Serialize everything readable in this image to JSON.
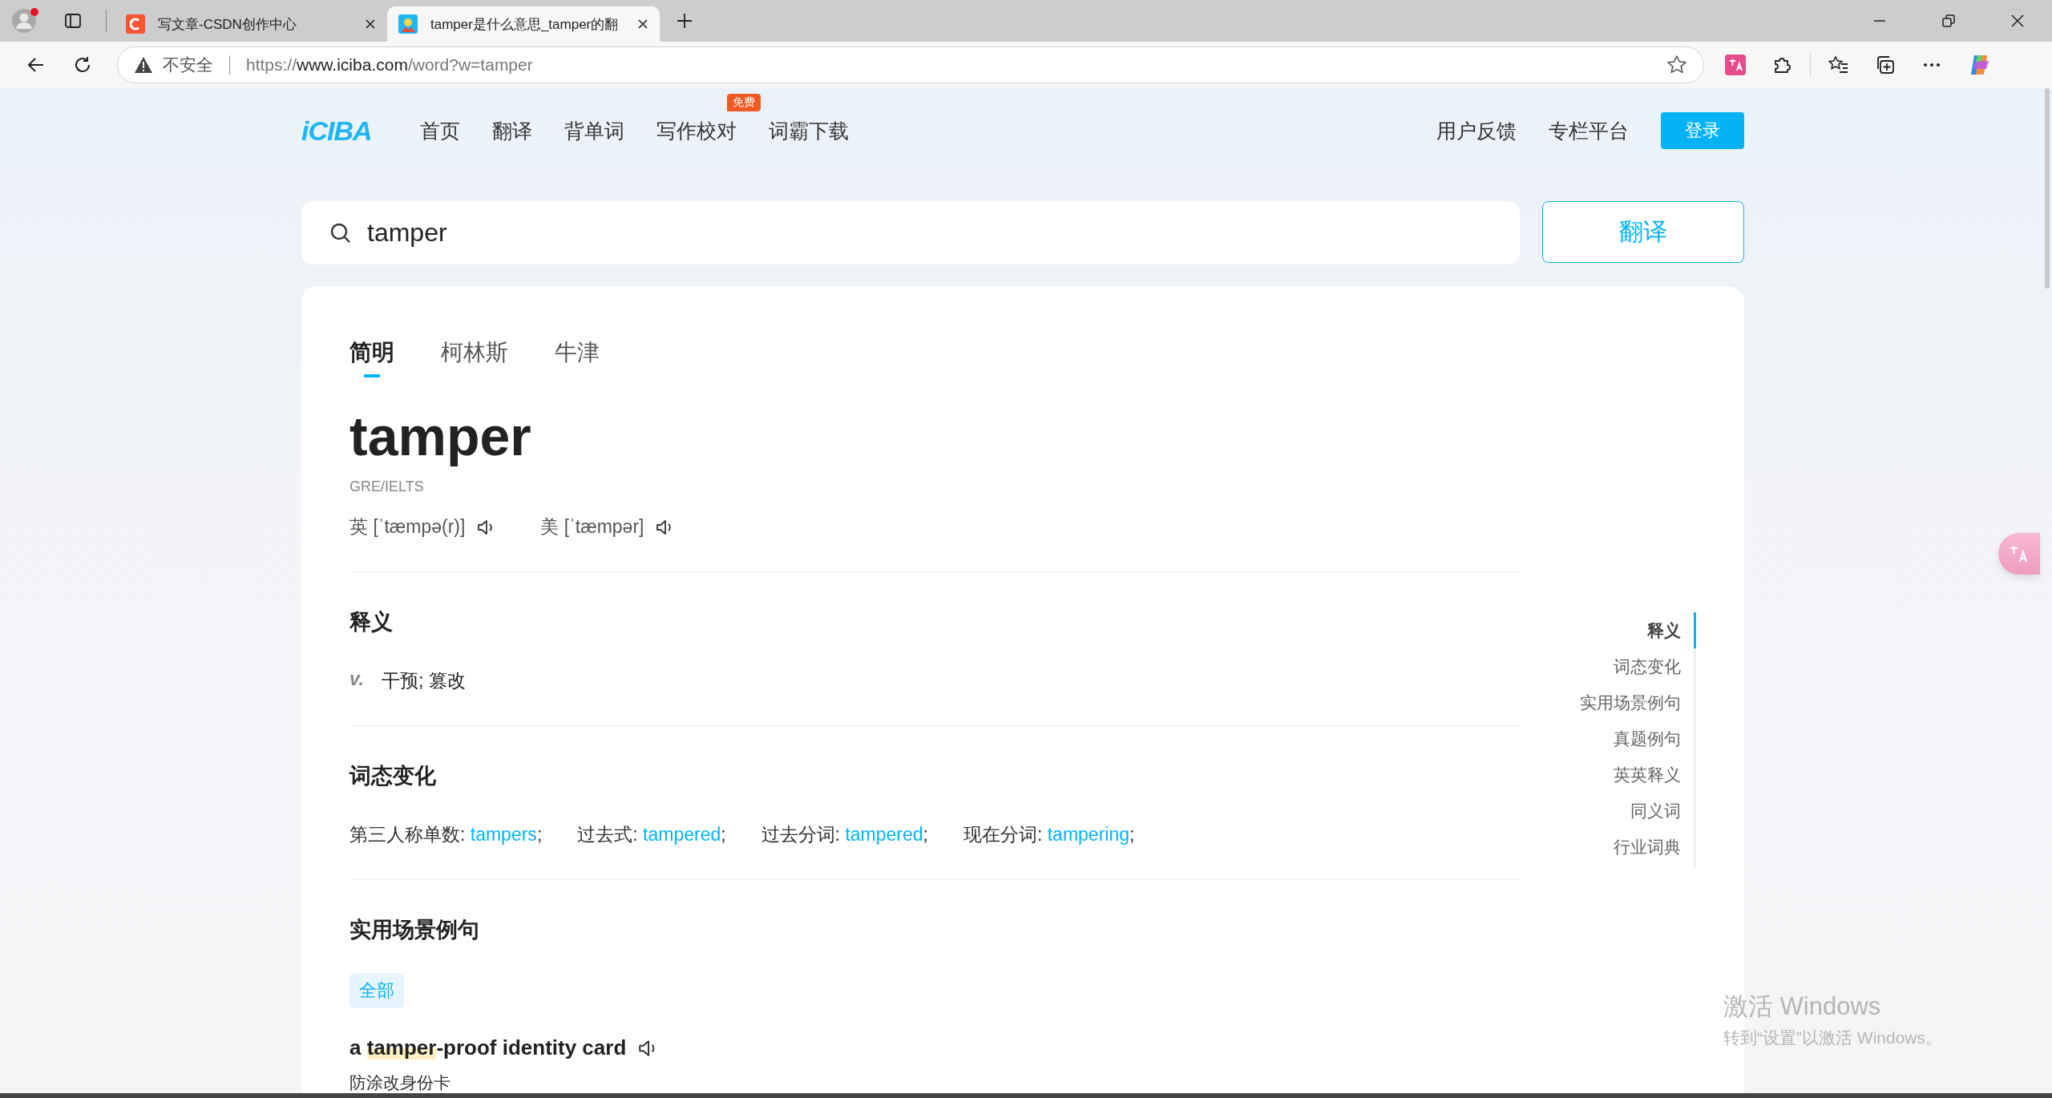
{
  "browser": {
    "tabs": [
      {
        "title": "写文章-CSDN创作中心",
        "kind": "csdn",
        "selected": false
      },
      {
        "title": "tamper是什么意思_tamper的翻",
        "kind": "iciba",
        "selected": true
      }
    ],
    "address": {
      "security": "不安全",
      "scheme": "https://",
      "host": "www.iciba.com",
      "path": "/word?w=tamper"
    }
  },
  "site": {
    "logo": "iCIBA",
    "nav": [
      {
        "label": "首页"
      },
      {
        "label": "翻译"
      },
      {
        "label": "背单词"
      },
      {
        "label": "写作校对",
        "badge": "免费"
      },
      {
        "label": "词霸下载"
      }
    ],
    "nav_right": [
      "用户反馈",
      "专栏平台"
    ],
    "login": "登录"
  },
  "search": {
    "value": "tamper",
    "button": "翻译"
  },
  "dict_tabs": [
    {
      "label": "简明",
      "selected": true
    },
    {
      "label": "柯林斯",
      "selected": false
    },
    {
      "label": "牛津",
      "selected": false
    }
  ],
  "word": "tamper",
  "tags": "GRE/IELTS",
  "pronunciations": [
    {
      "region": "英",
      "phonetic": "[ˈtæmpə(r)]"
    },
    {
      "region": "美",
      "phonetic": "[ˈtæmpər]"
    }
  ],
  "meaning": {
    "title": "释义",
    "items": [
      {
        "pos": "v.",
        "text": "干预; 篡改"
      }
    ]
  },
  "forms": {
    "title": "词态变化",
    "items": [
      {
        "label": "第三人称单数:",
        "word": "tampers",
        "sep": ";"
      },
      {
        "label": "过去式:",
        "word": "tampered",
        "sep": ";"
      },
      {
        "label": "过去分词:",
        "word": "tampered",
        "sep": ";"
      },
      {
        "label": "现在分词:",
        "word": "tampering",
        "sep": ";"
      }
    ]
  },
  "examples": {
    "title": "实用场景例句",
    "filters": [
      {
        "label": "全部",
        "selected": true
      }
    ],
    "items": [
      {
        "before": "a ",
        "highlight": "tamper",
        "after": "-proof identity card",
        "translation": "防涂改身份卡"
      }
    ]
  },
  "toc": [
    {
      "label": "释义",
      "selected": true
    },
    {
      "label": "词态变化",
      "selected": false
    },
    {
      "label": "实用场景例句",
      "selected": false
    },
    {
      "label": "真题例句",
      "selected": false
    },
    {
      "label": "英英释义",
      "selected": false
    },
    {
      "label": "同义词",
      "selected": false
    },
    {
      "label": "行业词典",
      "selected": false
    }
  ],
  "os_notice": {
    "title": "激活 Windows",
    "subtitle": "转到“设置”以激活 Windows。"
  }
}
